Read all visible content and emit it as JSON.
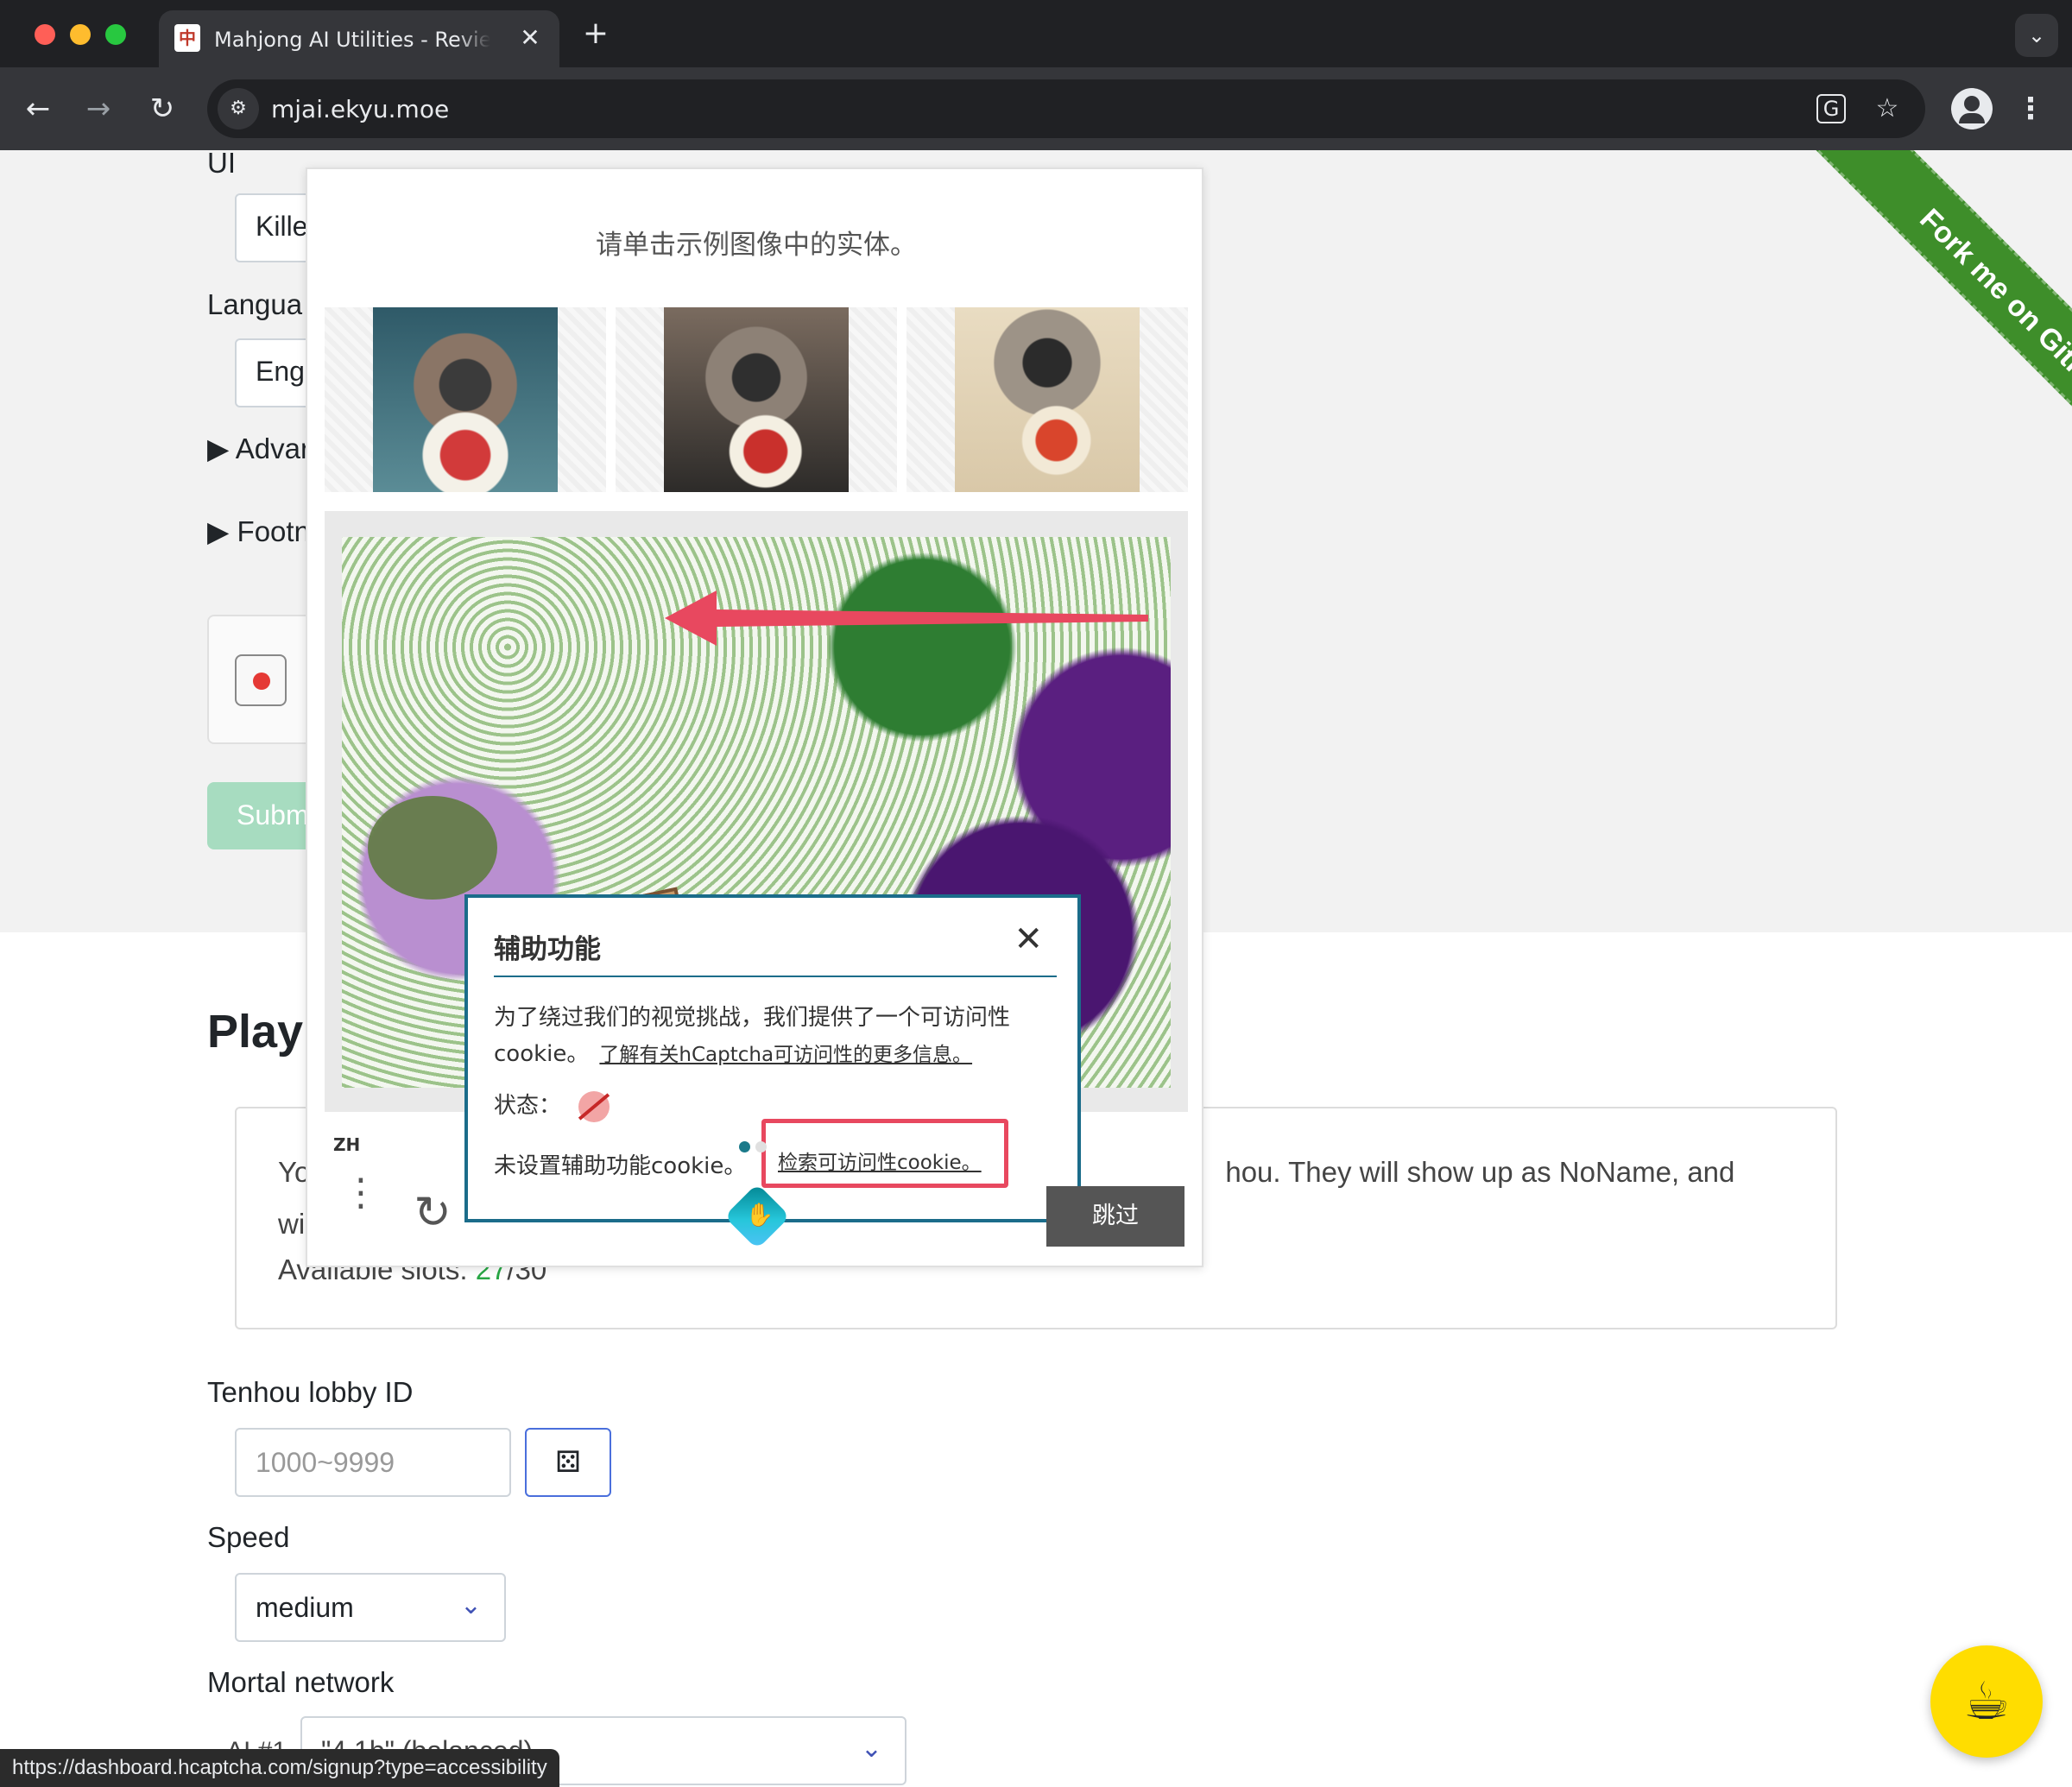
{
  "browser": {
    "tab_title": "Mahjong AI Utilities - Review",
    "tab_favicon": "中",
    "tab_close": "✕",
    "new_tab": "+",
    "tab_menu": "⌄",
    "back": "←",
    "forward": "→",
    "reload": "↻",
    "site_info": "⚙",
    "url": "mjai.ekyu.moe",
    "translate": "G",
    "star": "☆",
    "kebab": "⋮"
  },
  "page": {
    "ui_label": "UI",
    "ui_value": "Kille",
    "language_label": "Langua",
    "language_value": "Eng",
    "advanced_summary": "▶ Advar",
    "footnote_summary": "▶ Footn",
    "submit_label": "Subm",
    "play_title": "Play",
    "info_text": "You can play against Mortal on Tenhou. They will show up as NoName, and will leave the lobby automatically when the match ends.",
    "info_text_visible_left": "Yo",
    "info_text_visible_left2": "wi",
    "info_text_visible_right": "hou. They will show up as NoName, and",
    "available_slots_label": "Available slots: ",
    "available_slots_value": "27",
    "available_slots_total": "/30",
    "lobby_label": "Tenhou lobby ID",
    "lobby_placeholder": "1000~9999",
    "dice_icon": "⚄",
    "speed_label": "Speed",
    "speed_value": "medium",
    "chevron": "⌄",
    "mortal_label": "Mortal network",
    "ai_label": "AI #1",
    "ai_value": "\"4.1b\" (balanced)",
    "ribbon_text": "Fork me on GitHub",
    "coffee_icon": "☕"
  },
  "captcha": {
    "prompt": "请单击示例图像中的实体。",
    "samples": [
      "raccoon-sushi-1",
      "raccoon-sushi-2",
      "raccoon-sushi-3"
    ],
    "a11y_title": "辅助功能",
    "a11y_close": "✕",
    "a11y_text": "为了绕过我们的视觉挑战，我们提供了一个可访问性cookie。",
    "a11y_link": "了解有关hCaptcha可访问性的更多信息。",
    "status_label": "状态：",
    "no_cookie_text": "未设置辅助功能cookie。",
    "retrieve_link": "检索可访问性cookie。",
    "lang_code": "ZH",
    "menu": "⋮",
    "refresh": "↻",
    "skip_label": "跳过",
    "accent_color": "#1b6c8a",
    "highlight_color": "#e8485f"
  },
  "status_bar": {
    "url": "https://dashboard.hcaptcha.com/signup?type=accessibility"
  }
}
